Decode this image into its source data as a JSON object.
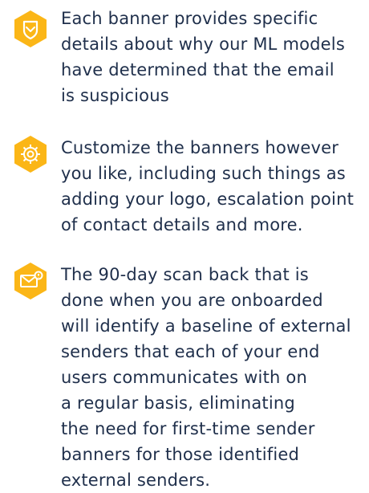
{
  "colors": {
    "accent": "#fbb617",
    "text": "#1f2f4b",
    "background": "#ffffff"
  },
  "features": [
    {
      "icon": "shield-icon",
      "text": "Each banner provides specific\ndetails about why our ML models\nhave determined that the email\nis suspicious"
    },
    {
      "icon": "gear-icon",
      "text": "Customize the banners however\nyou like, including such things as\nadding your logo, escalation point\nof contact details and more."
    },
    {
      "icon": "envelope-icon",
      "text": "The 90-day scan back that is\ndone when you are onboarded\nwill identify a baseline of external\nsenders that each of your end\nusers communicates with on\na regular basis, eliminating\nthe need for first-time sender\nbanners for those identified\nexternal senders."
    }
  ]
}
